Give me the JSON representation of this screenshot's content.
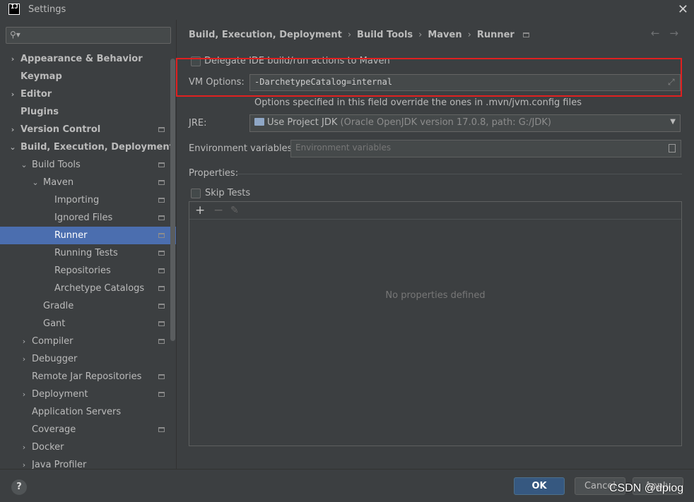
{
  "window": {
    "title": "Settings",
    "app_icon_text": "IJ"
  },
  "sidebar": {
    "search_placeholder": "",
    "items": [
      {
        "label": "Appearance & Behavior",
        "bold": true,
        "arrow": "›",
        "level": 0
      },
      {
        "label": "Keymap",
        "bold": true,
        "arrow": "",
        "level": 0
      },
      {
        "label": "Editor",
        "bold": true,
        "arrow": "›",
        "level": 0
      },
      {
        "label": "Plugins",
        "bold": true,
        "arrow": "",
        "level": 0
      },
      {
        "label": "Version Control",
        "bold": true,
        "arrow": "›",
        "level": 0,
        "mark": true
      },
      {
        "label": "Build, Execution, Deployment",
        "bold": true,
        "arrow": "⌄",
        "level": 0
      },
      {
        "label": "Build Tools",
        "arrow": "⌄",
        "level": 1,
        "mark": true
      },
      {
        "label": "Maven",
        "arrow": "⌄",
        "level": 2,
        "mark": true
      },
      {
        "label": "Importing",
        "level": 3,
        "mark": true
      },
      {
        "label": "Ignored Files",
        "level": 3,
        "mark": true
      },
      {
        "label": "Runner",
        "level": 3,
        "mark": true,
        "selected": true
      },
      {
        "label": "Running Tests",
        "level": 3,
        "mark": true
      },
      {
        "label": "Repositories",
        "level": 3,
        "mark": true
      },
      {
        "label": "Archetype Catalogs",
        "level": 3,
        "mark": true
      },
      {
        "label": "Gradle",
        "level": 2,
        "mark": true
      },
      {
        "label": "Gant",
        "level": 2,
        "mark": true
      },
      {
        "label": "Compiler",
        "arrow": "›",
        "level": 1,
        "mark": true
      },
      {
        "label": "Debugger",
        "arrow": "›",
        "level": 1
      },
      {
        "label": "Remote Jar Repositories",
        "level": 1,
        "mark": true
      },
      {
        "label": "Deployment",
        "arrow": "›",
        "level": 1,
        "mark": true
      },
      {
        "label": "Application Servers",
        "level": 1
      },
      {
        "label": "Coverage",
        "level": 1,
        "mark": true
      },
      {
        "label": "Docker",
        "arrow": "›",
        "level": 1
      },
      {
        "label": "Java Profiler",
        "arrow": "›",
        "level": 1
      }
    ]
  },
  "breadcrumb": [
    "Build, Execution, Deployment",
    "Build Tools",
    "Maven",
    "Runner"
  ],
  "breadcrumb_separator": "›",
  "nav": {
    "back": "←",
    "forward": "→"
  },
  "runner": {
    "delegate_label": "Delegate IDE build/run actions to Maven",
    "delegate_checked": false,
    "vm_options_label": "VM Options:",
    "vm_options_value": "-DarchetypeCatalog=internal",
    "vm_options_hint": "Options specified in this field override the ones in .mvn/jvm.config files",
    "jre_label": "JRE:",
    "jre_value": "Use Project JDK",
    "jre_detail": "(Oracle OpenJDK version 17.0.8, path: G:/JDK)",
    "env_label": "Environment variables:",
    "env_placeholder": "Environment variables",
    "properties_label": "Properties:",
    "skip_tests_label": "Skip Tests",
    "skip_tests_checked": false,
    "toolbar": {
      "add": "+",
      "remove": "−",
      "edit": "✎"
    },
    "empty_text": "No properties defined"
  },
  "buttons": {
    "help": "?",
    "ok": "OK",
    "cancel": "Cancel",
    "apply": "Apply"
  },
  "watermark": "CSDN @dpiog",
  "colors": {
    "selection": "#4b6eaf",
    "highlight_box": "#e02020",
    "ok_button": "#365880"
  }
}
